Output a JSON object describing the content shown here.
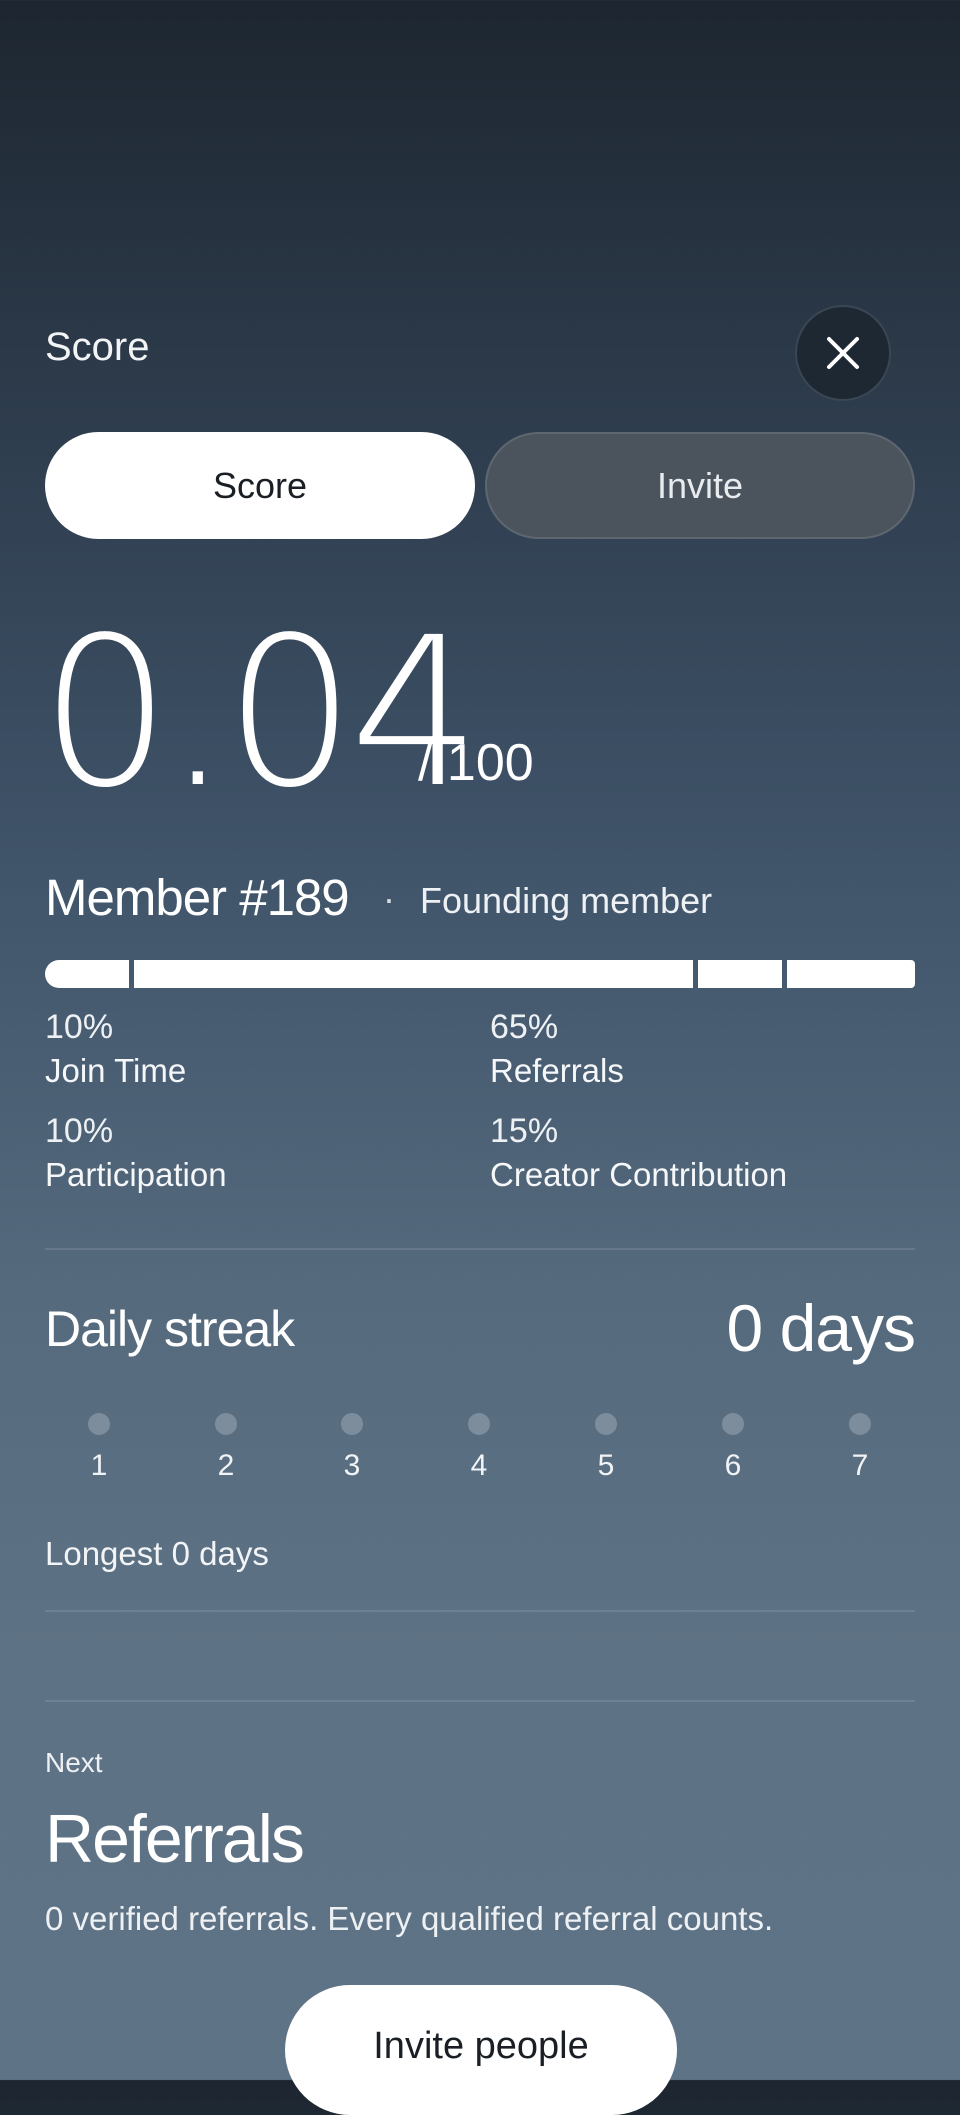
{
  "header": {
    "title": "Score"
  },
  "tabs": [
    {
      "label": "Score"
    },
    {
      "label": "Invite"
    }
  ],
  "score": {
    "value": "0.04",
    "max": "/ 100"
  },
  "member": {
    "number": "Member #189",
    "separator": "·",
    "tag": "Founding member"
  },
  "breakdown": [
    {
      "percent": "10%",
      "label": "Join Time"
    },
    {
      "percent": "65%",
      "label": "Referrals"
    },
    {
      "percent": "10%",
      "label": "Participation"
    },
    {
      "percent": "15%",
      "label": "Creator Contribution"
    }
  ],
  "streak": {
    "title": "Daily streak",
    "value": "0 days",
    "days": [
      "1",
      "2",
      "3",
      "4",
      "5",
      "6",
      "7"
    ],
    "longest": "Longest 0 days"
  },
  "next": {
    "label": "Next",
    "title": "Referrals",
    "description": "0 verified referrals. Every qualified referral counts."
  },
  "cta": {
    "label": "Invite people"
  },
  "icons": {
    "close": "close-icon"
  }
}
